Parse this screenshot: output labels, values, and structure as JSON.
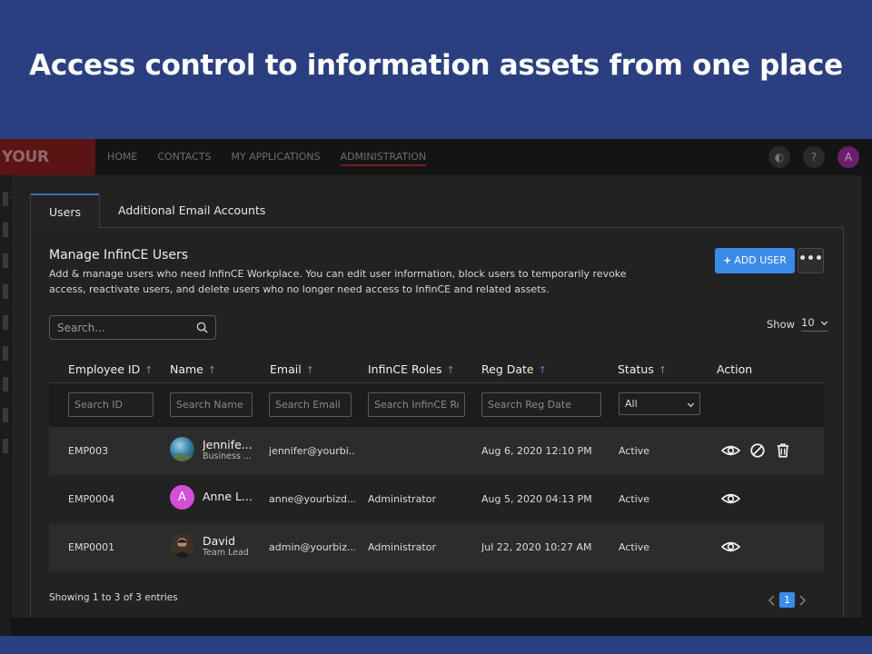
{
  "banner": {
    "title": "Access control to information assets from one place"
  },
  "topnav": {
    "logo": "YOUR LOGO",
    "links": [
      "HOME",
      "CONTACTS",
      "MY APPLICATIONS",
      "ADMINISTRATION"
    ],
    "active_link": "ADMINISTRATION",
    "avatar_initial": "A"
  },
  "tabs": [
    "Users",
    "Additional Email Accounts"
  ],
  "section": {
    "title": "Manage InfinCE Users",
    "description": "Add & manage users who need InfinCE Workplace. You can edit user information, block users to temporarily revoke access, reactivate users, and delete users who no longer need access to InfinCE and related assets."
  },
  "buttons": {
    "add_user": "ADD USER",
    "more": "•••"
  },
  "search": {
    "placeholder": "Search..."
  },
  "page_size": {
    "label": "Show",
    "value": "10"
  },
  "columns": [
    "Employee ID",
    "Name",
    "Email",
    "InfinCE Roles",
    "Reg Date",
    "Status",
    "Action"
  ],
  "sorted_column": "Reg Date",
  "filters": {
    "id_placeholder": "Search ID",
    "name_placeholder": "Search Name",
    "email_placeholder": "Search Email",
    "roles_placeholder": "Search InfinCE Roles",
    "regdate_placeholder": "Search Reg Date",
    "status_value": "All"
  },
  "rows": [
    {
      "id": "EMP003",
      "name": "Jennifer",
      "name_display": "Jennife...",
      "subtitle": "Business ...",
      "email": "jennifer@yourbi...",
      "role": "",
      "reg_date": "Aug 6, 2020 12:10 PM",
      "status": "Active",
      "avatar_initial": "",
      "actions": [
        "view",
        "block",
        "delete"
      ]
    },
    {
      "id": "EMP0004",
      "name": "Anne L",
      "name_display": "Anne L...",
      "subtitle": "",
      "email": "anne@yourbizd...",
      "role": "Administrator",
      "reg_date": "Aug 5, 2020 04:13 PM",
      "status": "Active",
      "avatar_initial": "A",
      "actions": [
        "view"
      ]
    },
    {
      "id": "EMP0001",
      "name": "David",
      "name_display": "David",
      "subtitle": "Team Lead",
      "email": "admin@yourbiz...",
      "role": "Administrator",
      "reg_date": "Jul 22, 2020 10:27 AM",
      "status": "Active",
      "avatar_initial": "",
      "actions": [
        "view"
      ]
    }
  ],
  "footer": {
    "entries": "Showing 1 to 3 of 3 entries",
    "current_page": "1"
  },
  "colors": {
    "accent": "#3a8be8",
    "banner_bg": "#2b3f80",
    "panel_bg": "#222222",
    "anne_avatar": "#d34fd8"
  },
  "icons": [
    "help-icon",
    "search-icon",
    "eye-icon",
    "block-icon",
    "trash-icon",
    "chevron-down-icon",
    "chevron-left-icon",
    "chevron-right-icon"
  ]
}
